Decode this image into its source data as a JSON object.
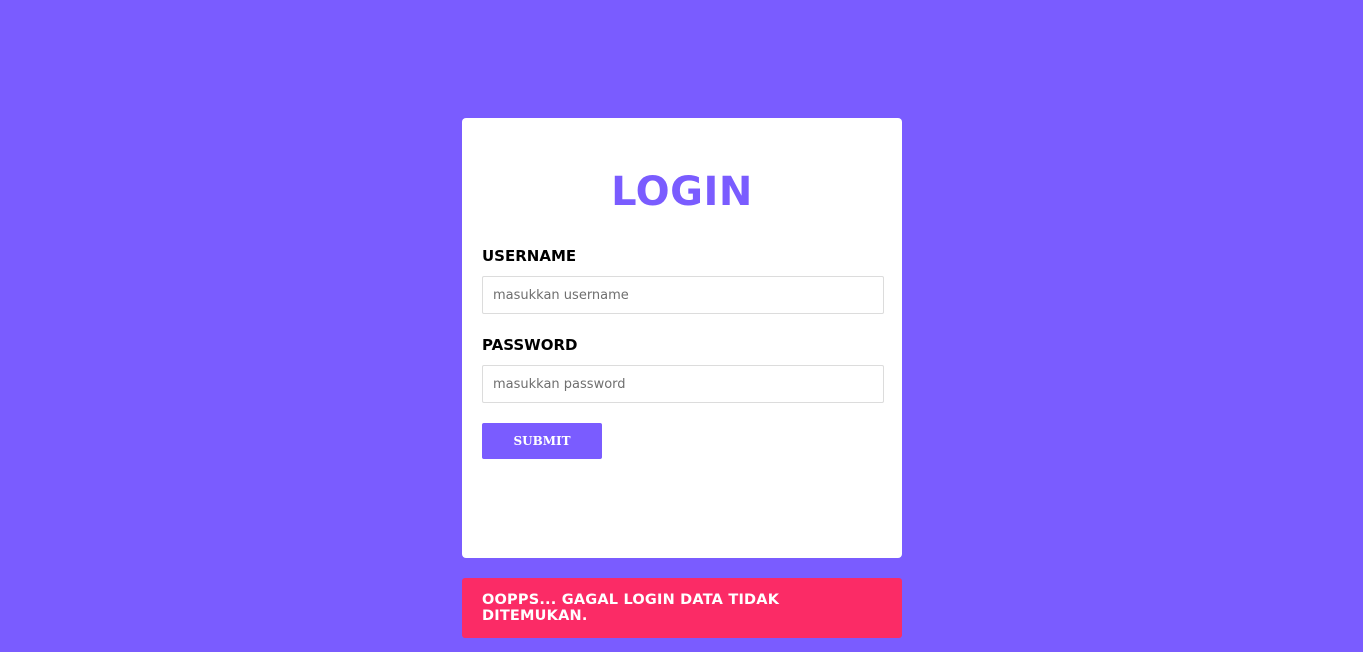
{
  "login_form": {
    "title": "LOGIN",
    "username_label": "USERNAME",
    "username_placeholder": "masukkan username",
    "username_value": "",
    "password_label": "PASSWORD",
    "password_placeholder": "masukkan password",
    "password_value": "",
    "submit_label": "SUBMIT"
  },
  "alert": {
    "message": "OOPPS... GAGAL LOGIN DATA TIDAK DITEMUKAN."
  },
  "colors": {
    "background": "#7a5cff",
    "accent": "#7a5cff",
    "card": "#ffffff",
    "error": "#fb2b66"
  }
}
